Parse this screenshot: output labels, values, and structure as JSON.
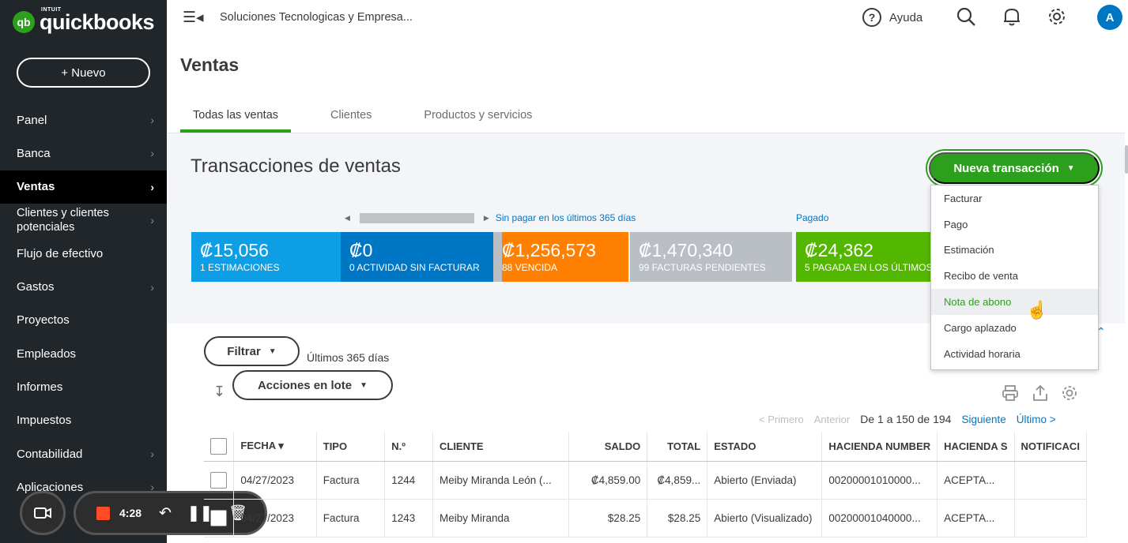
{
  "app": {
    "logo_intuit": "INTUIT",
    "logo_text": "quickbooks",
    "logo_badge": "qb",
    "new_label": "+  Nuevo"
  },
  "sidebar": {
    "items": [
      {
        "label": "Panel",
        "chevron": true
      },
      {
        "label": "Banca",
        "chevron": true
      },
      {
        "label": "Ventas",
        "chevron": true,
        "active": true
      },
      {
        "label": "Clientes y clientes potenciales",
        "chevron": true
      },
      {
        "label": "Flujo de efectivo",
        "chevron": false
      },
      {
        "label": "Gastos",
        "chevron": true
      },
      {
        "label": "Proyectos",
        "chevron": false
      },
      {
        "label": "Empleados",
        "chevron": false
      },
      {
        "label": "Informes",
        "chevron": false
      },
      {
        "label": "Impuestos",
        "chevron": false
      },
      {
        "label": "Contabilidad",
        "chevron": true
      },
      {
        "label": "Aplicaciones",
        "chevron": true
      }
    ]
  },
  "recorder": {
    "time": "4:28"
  },
  "topbar": {
    "company": "Soluciones Tecnologicas y Empresa...",
    "help_label": "Ayuda",
    "avatar_initial": "A"
  },
  "page": {
    "title": "Ventas",
    "tabs": [
      "Todas las ventas",
      "Clientes",
      "Productos y servicios"
    ]
  },
  "panel": {
    "title": "Transacciones de ventas",
    "new_transaction_label": "Nueva transacción",
    "unpaid_label": "Sin pagar en los últimos 365 días",
    "paid_label": "Pagado",
    "tiles": [
      {
        "amount": "₡15,056",
        "label": "1 ESTIMACIONES",
        "color": "#0d9ee6"
      },
      {
        "amount": "₡0",
        "label": "0 ACTIVIDAD SIN FACTURAR",
        "color": "#0077c5"
      },
      {
        "amount": "₡1,256,573",
        "label": "88 VENCIDA",
        "color": "#ff8000"
      },
      {
        "amount": "₡1,470,340",
        "label": "99 FACTURAS PENDIENTES",
        "color": "#babec5"
      },
      {
        "amount": "₡24,362",
        "label": "5 PAGADA EN LOS ÚLTIMOS 30 DÍAS",
        "color": "#53b700"
      }
    ]
  },
  "dropdown": {
    "items": [
      "Facturar",
      "Pago",
      "Estimación",
      "Recibo de venta",
      "Nota de abono",
      "Cargo aplazado",
      "Actividad horaria"
    ],
    "hover_index": 4
  },
  "filters": {
    "filter_label": "Filtrar",
    "range": "Últimos 365 días",
    "batch_label": "Acciones en lote"
  },
  "pager": {
    "first": "< Primero",
    "prev": "Anterior",
    "current": "De 1 a 150 de 194",
    "next": "Siguiente",
    "last": "Último >"
  },
  "table": {
    "headers": [
      "FECHA ▾",
      "TIPO",
      "N.º",
      "CLIENTE",
      "SALDO",
      "TOTAL",
      "ESTADO",
      "HACIENDA NUMBER",
      "HACIENDA S",
      "NOTIFICACI"
    ],
    "rows": [
      [
        "04/27/2023",
        "Factura",
        "1244",
        "Meiby Miranda León (...",
        "₡4,859.00",
        "₡4,859...",
        "Abierto (Enviada)",
        "00200001010000...",
        "ACEPTA...",
        ""
      ],
      [
        "04/27/2023",
        "Factura",
        "1243",
        "Meiby Miranda",
        "$28.25",
        "$28.25",
        "Abierto (Visualizado)",
        "00200001040000...",
        "ACEPTA...",
        ""
      ]
    ]
  }
}
